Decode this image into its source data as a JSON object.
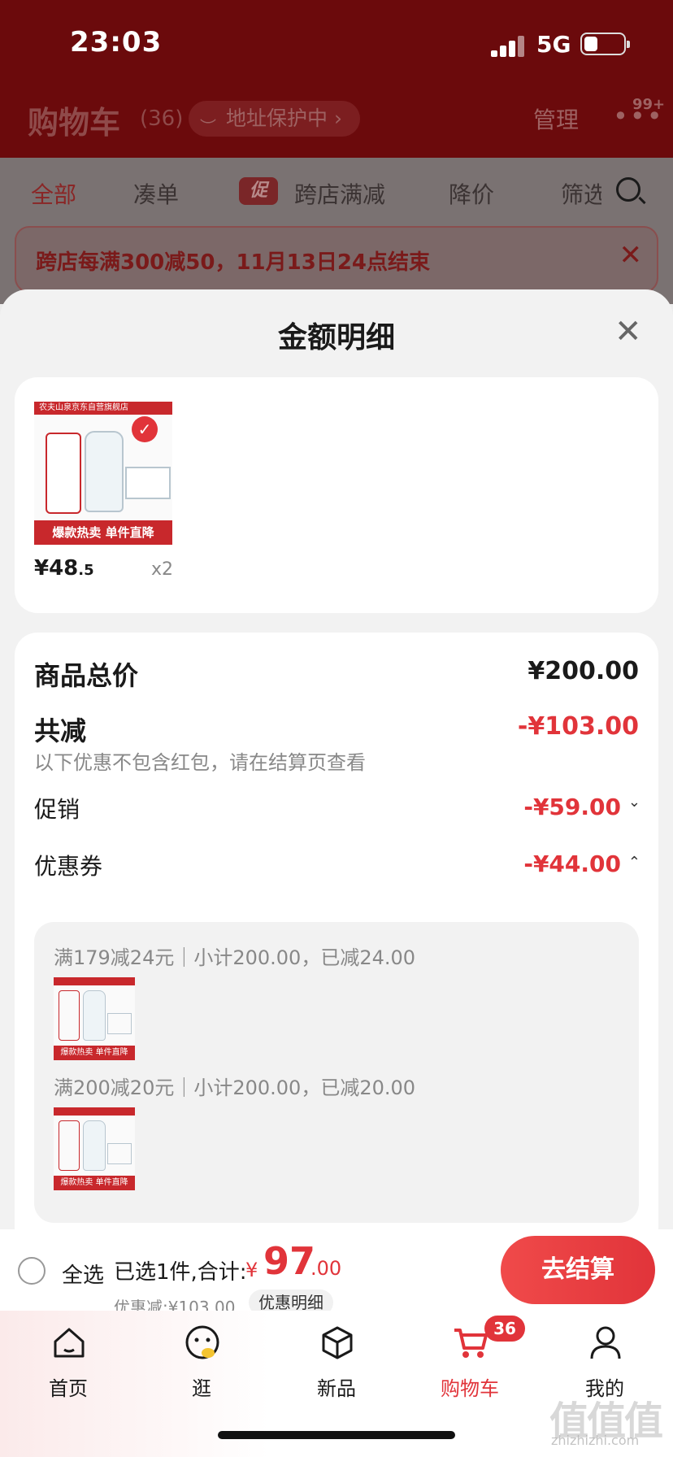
{
  "status": {
    "time": "23:03",
    "network": "5G"
  },
  "cart_header": {
    "title": "购物车",
    "count": "(36)",
    "address_protect": "地址保护中 ›",
    "manage": "管理",
    "more": "•••",
    "message_badge": "99+"
  },
  "filters": {
    "tabs": [
      "全部",
      "凑单",
      "跨店满减",
      "降价",
      "筛选"
    ],
    "promo_tag": "促"
  },
  "promo_banner": {
    "text": "跨店每满300减50，11月13日24点结束",
    "close": "✕"
  },
  "sheet": {
    "title": "金额明细",
    "close": "✕"
  },
  "product": {
    "store": "农夫山泉京东自营旗舰店",
    "banner": "爆款热卖 单件直降",
    "price_main": "¥48",
    "price_decimal": ".5",
    "quantity": "x2",
    "check": "✓"
  },
  "details": {
    "total_label": "商品总价",
    "total_value": "¥200.00",
    "reduced_label": "共减",
    "reduced_value": "-¥103.00",
    "reduced_note": "以下优惠不包含红包，请在结算页查看",
    "promo_label": "促销",
    "promo_value": "-¥59.00",
    "promo_chevron": "⌄",
    "coupon_label": "优惠券",
    "coupon_value": "-¥44.00",
    "coupon_chevron": "⌃",
    "coupons": [
      {
        "text": "满179减24元｜小计200.00，已减24.00",
        "thumb_banner": "爆款热卖 单件直降"
      },
      {
        "text": "满200减20元｜小计200.00，已减20.00",
        "thumb_banner": "爆款热卖 单件直降"
      }
    ]
  },
  "checkout": {
    "select_all": "全选",
    "summary": "已选1件,合计:",
    "currency": "¥",
    "total_int": "97",
    "total_dec": ".00",
    "discount": "优惠减:¥103.00",
    "detail_link": "优惠明细",
    "button": "去结算"
  },
  "tabbar": {
    "items": [
      {
        "label": "首页"
      },
      {
        "label": "逛"
      },
      {
        "label": "新品"
      },
      {
        "label": "购物车",
        "badge": "36"
      },
      {
        "label": "我的"
      }
    ]
  },
  "watermark": {
    "main": "值值值",
    "sub": "zhizhizhi.com"
  },
  "colors": {
    "accent": "#e1343a",
    "header": "#6b0a0c"
  }
}
